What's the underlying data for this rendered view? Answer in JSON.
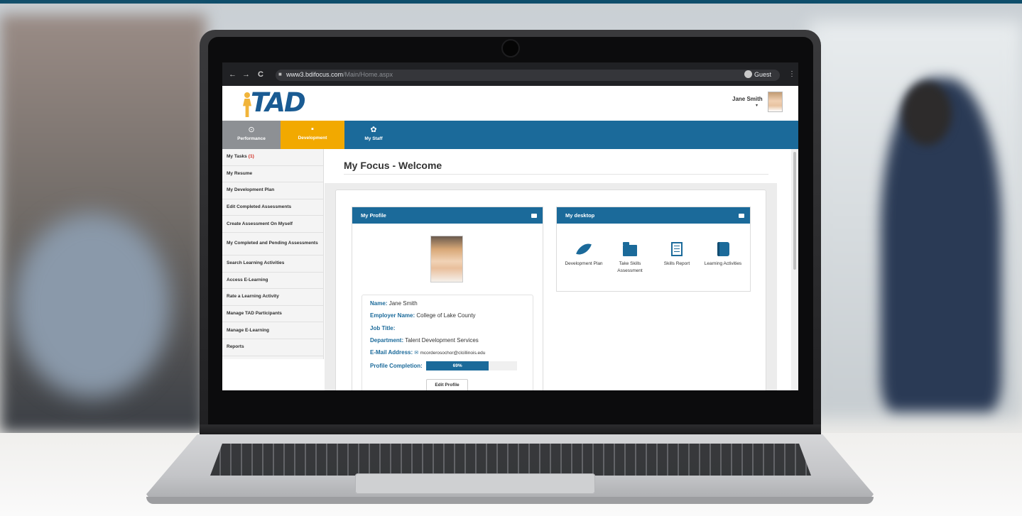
{
  "browser": {
    "back": "←",
    "forward": "→",
    "reload": "C",
    "url_host": "www3.bdifocus.com",
    "url_path": "/Main/Home.aspx",
    "profile": "Guest",
    "menu": "⋮"
  },
  "header": {
    "logo_text": "TAD",
    "user_name": "Jane Smith",
    "user_caret": "▾"
  },
  "tabs": [
    {
      "label": "Performance",
      "icon": "⊙"
    },
    {
      "label": "Development",
      "icon": "▪"
    },
    {
      "label": "My Staff",
      "icon": "✿"
    }
  ],
  "sidebar": {
    "items": [
      {
        "label": "My Tasks",
        "count": "(1)"
      },
      {
        "label": "My Resume"
      },
      {
        "label": "My Development Plan"
      },
      {
        "label": "Edit Completed Assessments"
      },
      {
        "label": "Create Assessment On Myself"
      },
      {
        "label": "My Completed and Pending Assessments"
      },
      {
        "label": "Search Learning Activities"
      },
      {
        "label": "Access E-Learning"
      },
      {
        "label": "Rate a Learning Activity"
      },
      {
        "label": "Manage TAD Participants"
      },
      {
        "label": "Manage E-Learning"
      },
      {
        "label": "Reports"
      }
    ]
  },
  "main": {
    "title": "My Focus - Welcome"
  },
  "profile": {
    "panel_title": "My Profile",
    "name_label": "Name:",
    "name": "Jane Smith",
    "employer_label": "Employer Name:",
    "employer": "College of Lake County",
    "job_title_label": "Job Title:",
    "department_label": "Department:",
    "department": "Talent Development Services",
    "email_label": "E-Mail Address:",
    "email_icon": "✉",
    "email": "mcorderosochor@clcillinois.edu",
    "completion_label": "Profile Completion:",
    "completion_text": "69%",
    "completion_fraction": 0.69,
    "edit_button": "Edit Profile"
  },
  "desktop": {
    "panel_title": "My desktop",
    "items": [
      {
        "label": "Development Plan",
        "icon": "leaf-icon"
      },
      {
        "label": "Take Skills Assessment",
        "icon": "folder-icon"
      },
      {
        "label": "Skills Report",
        "icon": "report-icon"
      },
      {
        "label": "Learning Activities",
        "icon": "book-icon"
      }
    ]
  },
  "colors": {
    "brand_blue": "#1b6a9a",
    "brand_orange": "#f2a900",
    "tab_gray": "#8d9094",
    "task_count_red": "#d0251a"
  }
}
